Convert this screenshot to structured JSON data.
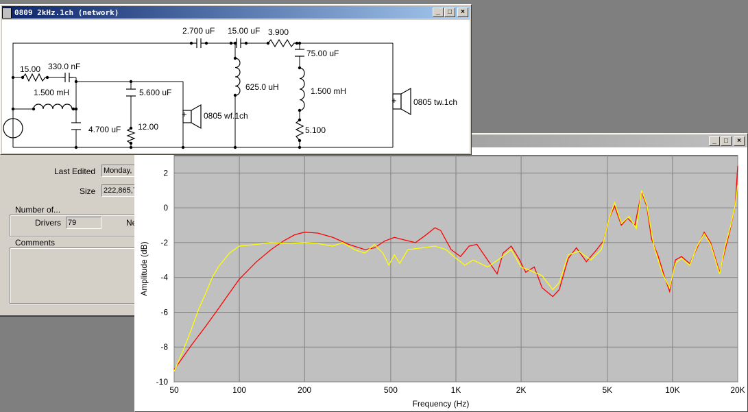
{
  "network_window": {
    "title": "0809 2kHz.1ch (network)",
    "components": {
      "c1": "2.700 uF",
      "c2": "15.00 uF",
      "r3": "3.900",
      "c4": "75.00 uF",
      "r1": "15.00",
      "c5": "330.0 nF",
      "l1": "1.500 mH",
      "c6": "5.600 uF",
      "l2": "625.0 uH",
      "l3": "1.500 mH",
      "c7": "4.700 uF",
      "r2": "12.00",
      "r4": "5.100",
      "woofer": "0805 wf.1ch",
      "tweeter": "0805 tw.1ch"
    }
  },
  "info_panel": {
    "last_edited_label": "Last Edited",
    "last_edited_value": "Monday,",
    "size_label": "Size",
    "size_value": "222,865,7",
    "number_of_label": "Number of...",
    "drivers_label": "Drivers",
    "drivers_value": "79",
    "ne_label": "Ne",
    "comments_label": "Comments"
  },
  "chart_data": {
    "type": "line",
    "title": "",
    "xlabel": "Frequency (Hz)",
    "ylabel": "Amplitude (dB)",
    "xscale": "log",
    "xlim": [
      50,
      20000
    ],
    "ylim": [
      -10,
      3
    ],
    "x_ticks": [
      50,
      100,
      200,
      500,
      1000,
      2000,
      5000,
      10000,
      20000
    ],
    "x_tick_labels": [
      "50",
      "100",
      "200",
      "500",
      "1K",
      "2K",
      "5K",
      "10K",
      "20K"
    ],
    "y_ticks": [
      -10,
      -8,
      -6,
      -4,
      -2,
      0,
      2
    ],
    "y_tick_labels": [
      "-10",
      "-8",
      "-6",
      "-4",
      "-2",
      "0",
      "2"
    ],
    "grid": true,
    "series": [
      {
        "color": "#ff0000",
        "points": [
          [
            50,
            -9.3
          ],
          [
            60,
            -7.9
          ],
          [
            70,
            -6.8
          ],
          [
            80,
            -5.8
          ],
          [
            90,
            -4.9
          ],
          [
            100,
            -4.1
          ],
          [
            120,
            -3.1
          ],
          [
            140,
            -2.4
          ],
          [
            160,
            -1.9
          ],
          [
            180,
            -1.55
          ],
          [
            200,
            -1.4
          ],
          [
            230,
            -1.45
          ],
          [
            270,
            -1.7
          ],
          [
            320,
            -2.1
          ],
          [
            380,
            -2.4
          ],
          [
            420,
            -2.3
          ],
          [
            470,
            -1.9
          ],
          [
            520,
            -1.7
          ],
          [
            580,
            -1.85
          ],
          [
            650,
            -2.0
          ],
          [
            720,
            -1.6
          ],
          [
            800,
            -1.15
          ],
          [
            850,
            -1.3
          ],
          [
            950,
            -2.4
          ],
          [
            1050,
            -2.8
          ],
          [
            1150,
            -2.2
          ],
          [
            1250,
            -2.1
          ],
          [
            1400,
            -3.0
          ],
          [
            1550,
            -3.8
          ],
          [
            1650,
            -2.6
          ],
          [
            1800,
            -2.2
          ],
          [
            1950,
            -2.9
          ],
          [
            2100,
            -3.7
          ],
          [
            2300,
            -3.4
          ],
          [
            2500,
            -4.6
          ],
          [
            2800,
            -5.1
          ],
          [
            3000,
            -4.7
          ],
          [
            3300,
            -2.9
          ],
          [
            3600,
            -2.3
          ],
          [
            4000,
            -3.1
          ],
          [
            4400,
            -2.5
          ],
          [
            4800,
            -1.9
          ],
          [
            5100,
            -0.6
          ],
          [
            5400,
            0.1
          ],
          [
            5800,
            -1.0
          ],
          [
            6200,
            -0.6
          ],
          [
            6700,
            -1.0
          ],
          [
            7200,
            0.9
          ],
          [
            7600,
            0.1
          ],
          [
            8000,
            -1.8
          ],
          [
            8600,
            -2.8
          ],
          [
            9200,
            -4.0
          ],
          [
            9700,
            -4.8
          ],
          [
            10300,
            -3.0
          ],
          [
            11000,
            -2.8
          ],
          [
            12000,
            -3.2
          ],
          [
            13000,
            -2.3
          ],
          [
            14000,
            -1.4
          ],
          [
            15000,
            -2.0
          ],
          [
            16500,
            -3.7
          ],
          [
            17500,
            -2.4
          ],
          [
            18500,
            -1.2
          ],
          [
            19500,
            0.2
          ],
          [
            20000,
            2.4
          ]
        ]
      },
      {
        "color": "#ffff00",
        "points": [
          [
            50,
            -9.4
          ],
          [
            55,
            -8.2
          ],
          [
            60,
            -7.0
          ],
          [
            65,
            -5.8
          ],
          [
            70,
            -4.9
          ],
          [
            75,
            -4.0
          ],
          [
            80,
            -3.4
          ],
          [
            90,
            -2.6
          ],
          [
            100,
            -2.2
          ],
          [
            120,
            -2.1
          ],
          [
            140,
            -2.0
          ],
          [
            170,
            -2.05
          ],
          [
            200,
            -2.0
          ],
          [
            230,
            -2.05
          ],
          [
            270,
            -2.2
          ],
          [
            300,
            -2.0
          ],
          [
            340,
            -2.4
          ],
          [
            380,
            -2.6
          ],
          [
            420,
            -2.1
          ],
          [
            460,
            -2.6
          ],
          [
            490,
            -3.3
          ],
          [
            520,
            -2.7
          ],
          [
            550,
            -3.2
          ],
          [
            600,
            -2.4
          ],
          [
            700,
            -2.3
          ],
          [
            800,
            -2.2
          ],
          [
            900,
            -2.4
          ],
          [
            1000,
            -2.9
          ],
          [
            1100,
            -3.3
          ],
          [
            1200,
            -3.0
          ],
          [
            1400,
            -3.4
          ],
          [
            1600,
            -2.9
          ],
          [
            1800,
            -2.4
          ],
          [
            2000,
            -3.4
          ],
          [
            2200,
            -3.6
          ],
          [
            2500,
            -3.9
          ],
          [
            2800,
            -4.7
          ],
          [
            3000,
            -4.3
          ],
          [
            3300,
            -2.7
          ],
          [
            3700,
            -2.5
          ],
          [
            4200,
            -3.0
          ],
          [
            4700,
            -2.4
          ],
          [
            5100,
            -0.6
          ],
          [
            5400,
            0.3
          ],
          [
            5800,
            -0.9
          ],
          [
            6300,
            -0.5
          ],
          [
            6800,
            -1.2
          ],
          [
            7200,
            1.0
          ],
          [
            7600,
            0.2
          ],
          [
            8200,
            -2.2
          ],
          [
            9000,
            -3.8
          ],
          [
            9700,
            -4.6
          ],
          [
            10300,
            -3.2
          ],
          [
            11000,
            -2.9
          ],
          [
            12000,
            -3.3
          ],
          [
            13000,
            -2.2
          ],
          [
            14000,
            -1.5
          ],
          [
            15000,
            -2.1
          ],
          [
            16500,
            -3.8
          ],
          [
            17500,
            -2.2
          ],
          [
            18500,
            -1.1
          ],
          [
            19500,
            0.2
          ],
          [
            20000,
            1.3
          ]
        ]
      }
    ]
  }
}
